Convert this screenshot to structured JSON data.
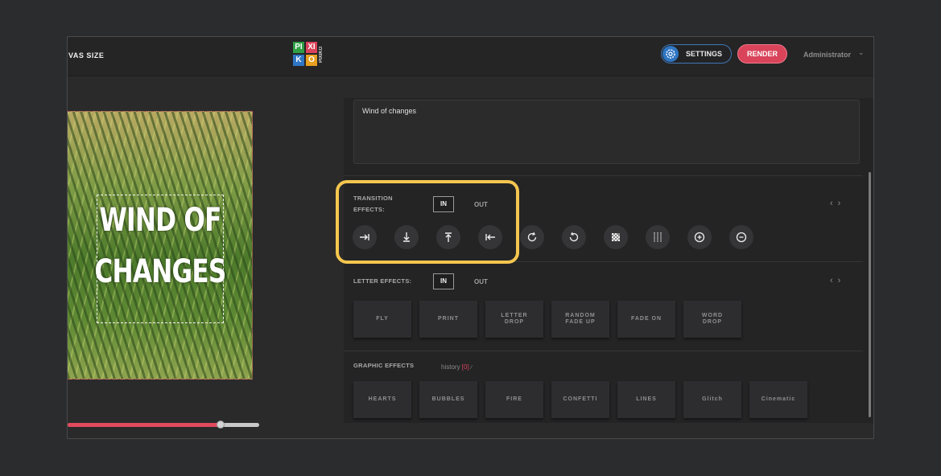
{
  "header": {
    "canvas_size_label": "NVAS SIZE",
    "logo": {
      "letters": [
        "PI",
        "XI",
        "K",
        "O"
      ],
      "side_text": "PIXIKO"
    },
    "settings_label": "SETTINGS",
    "render_label": "RENDER",
    "user_name": "Administrator"
  },
  "preview": {
    "text_line1": "WIND OF",
    "text_line2": "CHANGES",
    "timeline_progress": 0.8
  },
  "editor": {
    "text_value": "Wind of changes"
  },
  "transition_effects": {
    "label_line1": "TRANSITION",
    "label_line2": "EFFECTS:",
    "in_label": "IN",
    "out_label": "OUT",
    "icons": [
      "slide-right-icon",
      "slide-down-icon",
      "slide-up-icon",
      "slide-left-icon",
      "rotate-cw-icon",
      "rotate-ccw-icon",
      "dissolve-icon",
      "blinds-icon",
      "zoom-in-icon",
      "zoom-out-icon"
    ]
  },
  "letter_effects": {
    "label": "LETTER EFFECTS:",
    "in_label": "IN",
    "out_label": "OUT",
    "items": [
      "FLY",
      "PRINT",
      "LETTER\nDROP",
      "RANDOM\nFADE UP",
      "FADE ON",
      "WORD\nDROP"
    ]
  },
  "graphic_effects": {
    "label": "GRAPHIC EFFECTS",
    "history_label": "history",
    "history_count": "[0]",
    "items": [
      "HEARTS",
      "BUBBLES",
      "FIRE",
      "CONFETTI",
      "LINES",
      "Glitch",
      "Cinematic"
    ]
  },
  "colors": {
    "accent_blue": "#2f76c4",
    "render_red": "#d9445a",
    "highlight_yellow": "#f5c64f",
    "timeline_red": "#e24a5d"
  }
}
